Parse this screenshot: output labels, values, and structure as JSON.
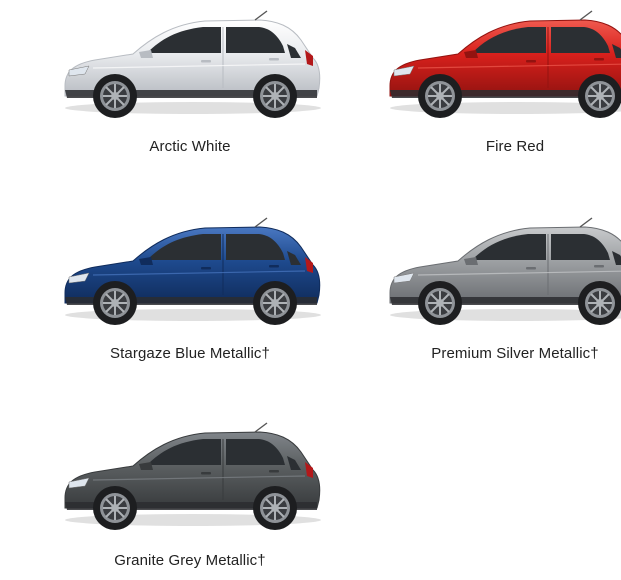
{
  "colors": [
    {
      "name": "Arctic White",
      "body": "#e9ebee",
      "shade": "#b8bcc2",
      "highlight": "#ffffff"
    },
    {
      "name": "Fire Red",
      "body": "#d8201c",
      "shade": "#931310",
      "highlight": "#f05a4f"
    },
    {
      "name": "Stargaze Blue Metallic†",
      "body": "#1e4a8e",
      "shade": "#102c5c",
      "highlight": "#4a78c2"
    },
    {
      "name": "Premium Silver Metallic†",
      "body": "#9da0a3",
      "shade": "#6b6e72",
      "highlight": "#c8cacc"
    },
    {
      "name": "Granite Grey Metallic†",
      "body": "#5b5f61",
      "shade": "#383b3d",
      "highlight": "#80858a"
    }
  ]
}
